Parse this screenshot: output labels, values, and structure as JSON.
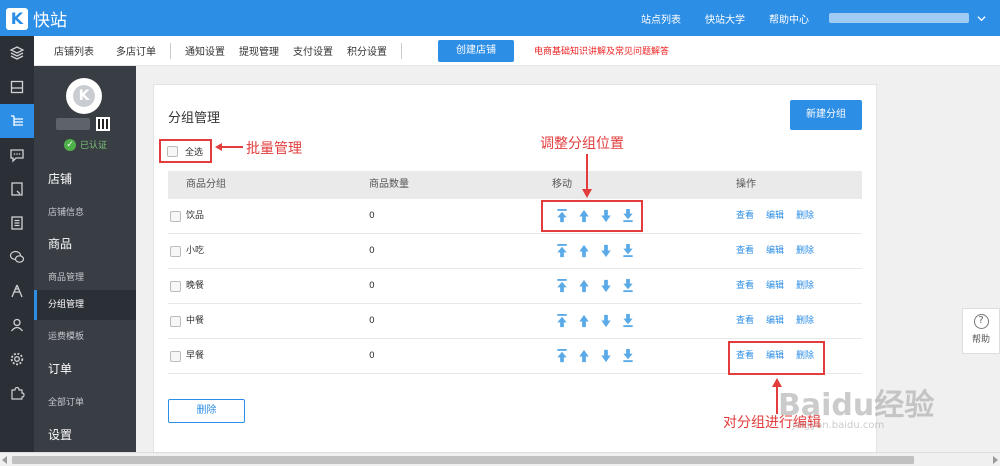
{
  "app": {
    "logo_letter": "K",
    "title": "快站"
  },
  "topbar": {
    "links": [
      "站点列表",
      "快站大学",
      "帮助中心"
    ]
  },
  "subnav": {
    "items": [
      "店铺列表",
      "多店订单",
      "通知设置",
      "提现管理",
      "支付设置",
      "积分设置"
    ],
    "create_button": "创建店铺",
    "notice": "电商基础知识讲解及常见问题解答"
  },
  "rail_icons": [
    "layers-icon",
    "store-icon",
    "list-icon",
    "chat-icon",
    "page-icon",
    "document-icon",
    "wechat-icon",
    "tower-icon",
    "user-icon",
    "gear-icon",
    "puzzle-icon"
  ],
  "profile": {
    "avatar_letter": "K",
    "verified": "已认证"
  },
  "sidebar": {
    "store_header": "店铺",
    "store_info": "店铺信息",
    "goods_header": "商品",
    "goods_manage": "商品管理",
    "group_manage": "分组管理",
    "shipping_template": "运费模板",
    "orders_header": "订单",
    "all_orders": "全部订单",
    "settings_header": "设置"
  },
  "panel": {
    "title": "分组管理",
    "new_button": "新建分组",
    "select_all": "全选",
    "columns": [
      "商品分组",
      "商品数量",
      "移动",
      "操作"
    ],
    "rows": [
      {
        "name": "饮品",
        "count": "0"
      },
      {
        "name": "小吃",
        "count": "0"
      },
      {
        "name": "晚餐",
        "count": "0"
      },
      {
        "name": "中餐",
        "count": "0"
      },
      {
        "name": "早餐",
        "count": "0"
      }
    ],
    "actions": [
      "查看",
      "编辑",
      "删除"
    ],
    "delete_button": "删除"
  },
  "annotations": {
    "batch": "批量管理",
    "adjust": "调整分组位置",
    "edit": "对分组进行编辑"
  },
  "help": {
    "label": "帮助"
  },
  "watermark": {
    "main": "Baidu经验",
    "url": "jingyan.baidu.com"
  },
  "colors": {
    "primary": "#2d8ee6",
    "annotation": "#e23c3c",
    "sidebar": "#393d44",
    "rail": "#2b2f36"
  }
}
